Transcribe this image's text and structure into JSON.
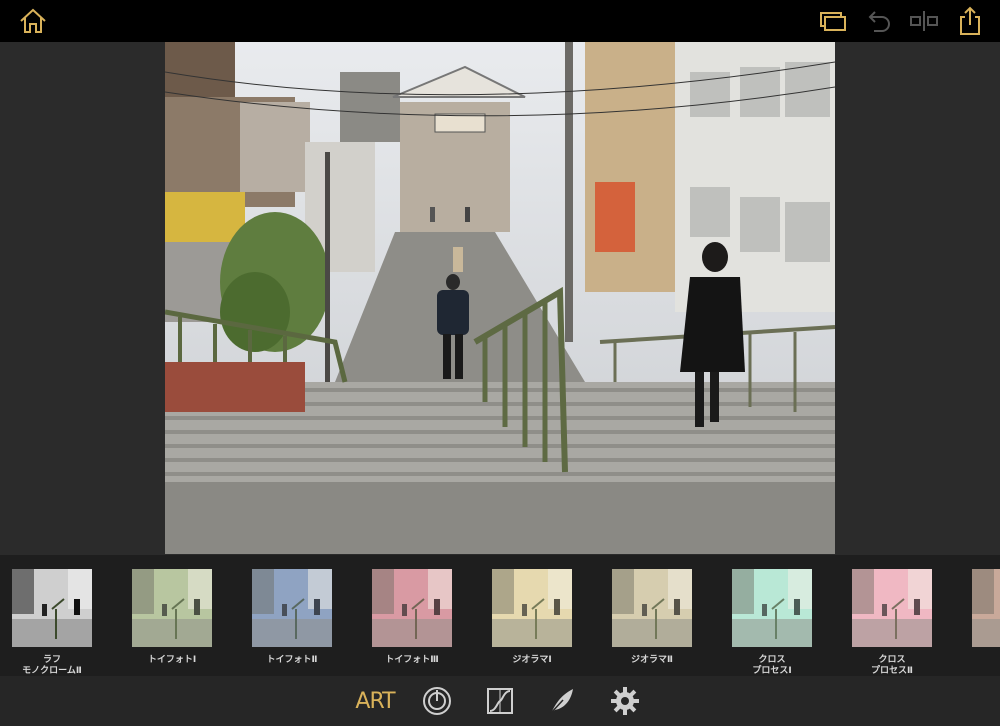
{
  "toolbar": {
    "home_icon": "home-icon",
    "compare_icon": "layers-icon",
    "undo_icon": "undo-icon",
    "split_icon": "split-view-icon",
    "share_icon": "share-icon",
    "accent": "#d9b25a"
  },
  "photo": {
    "description_icon": "street-stairs-photo"
  },
  "filters": [
    {
      "label": "ラフ\nモノクロームⅡ",
      "tint": "mono"
    },
    {
      "label": "トイフォトⅠ",
      "tint": "#b8c7a0"
    },
    {
      "label": "トイフォトⅡ",
      "tint": "#8fa3c2"
    },
    {
      "label": "トイフォトⅢ",
      "tint": "#d99aa3"
    },
    {
      "label": "ジオラマⅠ",
      "tint": "#e6d9b0"
    },
    {
      "label": "ジオラマⅡ",
      "tint": "#d6cdb0"
    },
    {
      "label": "クロス\nプロセスⅠ",
      "tint": "#b9e8d6"
    },
    {
      "label": "クロス\nプロセスⅡ",
      "tint": "#f0b8c4"
    },
    {
      "label": "ジ",
      "tint": "#c9a99a"
    }
  ],
  "bottom_tabs": {
    "art_label": "ART",
    "dial_icon": "dial-icon",
    "adjust_icon": "curves-icon",
    "brush_icon": "feather-icon",
    "settings_icon": "gear-icon"
  }
}
